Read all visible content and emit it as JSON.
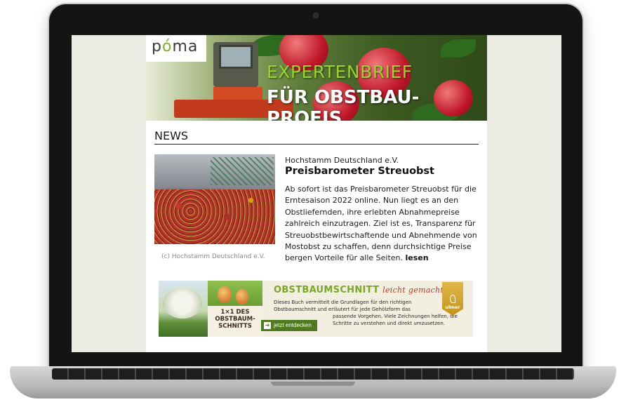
{
  "newsletter": {
    "logo": {
      "before": "p",
      "accent": "ó",
      "after": "ma"
    },
    "hero": {
      "title_line1": "EXPERTENBRIEF",
      "title_line2": "FÜR OBSTBAU-PROFIS"
    },
    "section_heading": "NEWS",
    "article": {
      "source": "Hochstamm Deutschland e.V.",
      "title": "Preisbarometer Streuobst",
      "body": "Ab sofort ist das Preisbarometer Streuobst für die Erntesaison 2022 online. Nun liegt es an den Obstliefernden, ihre erlebten Abnahmepreise zahlreich einzutragen. Ziel ist es, Transparenz für Streuobstbewirtschaftende und Abnehmende von Mostobst zu schaffen, denn durchsichtige Preise bergen Vorteile für alle Seiten.",
      "read_more": "lesen",
      "photo_credit": "(c) Hochstamm Deutschland e.V."
    },
    "ad": {
      "headline": "OBSTBAUMSCHNITT",
      "tagline": "leicht gemacht",
      "text_1": "Dieses Buch vermittelt die Grundlagen für den richtigen Obstbaumschnitt und erläutert für jede Gehölzform das",
      "text_2": "passende Vorgehen. Viele Zeichnungen helfen, die Schritte zu verstehen und direkt umzusetzen.",
      "button_label": "jetzt entdecken",
      "book_title": "1×1 DES OBSTBAUM-SCHNITTS",
      "publisher": "ulmer"
    }
  },
  "colors": {
    "accent_green": "#9ad330",
    "ad_green": "#7aa52a",
    "button_green": "#4f7a1f",
    "publisher_gold": "#c29420"
  },
  "icons": {
    "ad_button_icon": "arrow-right-icon",
    "camera": "webcam-icon"
  }
}
